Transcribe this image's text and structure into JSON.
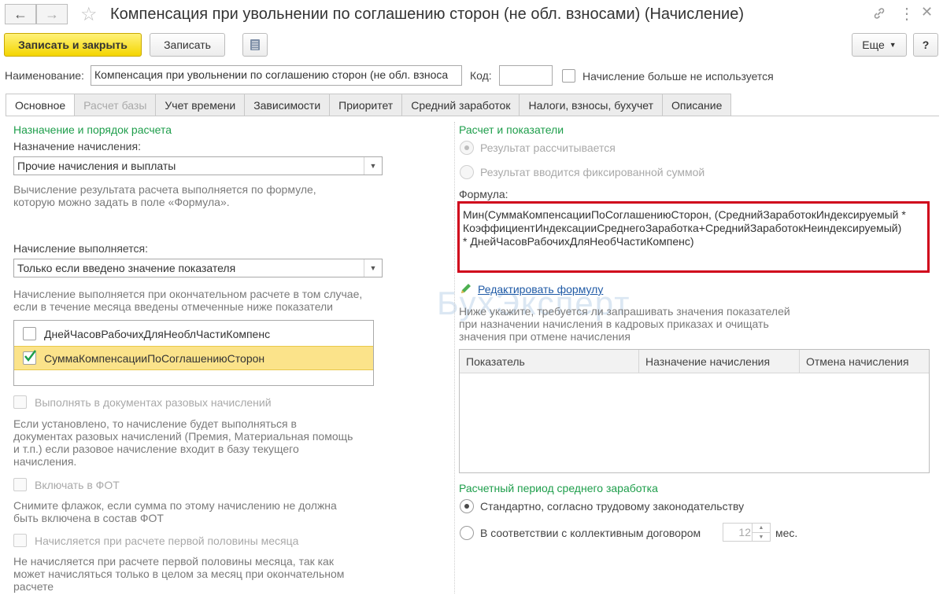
{
  "window": {
    "title": "Компенсация при увольнении по соглашению сторон (не обл. взносами) (Начисление)"
  },
  "toolbar": {
    "save_close": "Записать и закрыть",
    "save": "Записать",
    "more": "Еще",
    "help": "?"
  },
  "header": {
    "name_label": "Наименование:",
    "name_value": "Компенсация при увольнении по соглашению сторон (не обл. взноса",
    "code_label": "Код:",
    "code_value": "",
    "not_used_label": "Начисление больше не используется"
  },
  "tabs": [
    {
      "label": "Основное"
    },
    {
      "label": "Расчет базы"
    },
    {
      "label": "Учет времени"
    },
    {
      "label": "Зависимости"
    },
    {
      "label": "Приоритет"
    },
    {
      "label": "Средний заработок"
    },
    {
      "label": "Налоги, взносы, бухучет"
    },
    {
      "label": "Описание"
    }
  ],
  "left": {
    "group_title": "Назначение и порядок расчета",
    "purpose_label": "Назначение начисления:",
    "purpose_value": "Прочие начисления и выплаты",
    "purpose_note_1": "Вычисление результата расчета выполняется по формуле,",
    "purpose_note_2": "которую можно задать в поле «Формула».",
    "exec_label": "Начисление выполняется:",
    "exec_value": "Только если введено значение показателя",
    "exec_note_1": "Начисление выполняется при окончательном расчете в том случае,",
    "exec_note_2": "если в течение месяца введены отмеченные ниже показатели",
    "indicators": [
      {
        "label": "ДнейЧасовРабочихДляНеоблЧастиКомпенс",
        "checked": false
      },
      {
        "label": "СуммаКомпенсацииПоСоглашениюСторон",
        "checked": true
      }
    ],
    "one_time_label": "Выполнять в документах разовых начислений",
    "one_time_note_1": "Если установлено, то начисление будет выполняться в",
    "one_time_note_2": "документах разовых начислений (Премия, Материальная помощь",
    "one_time_note_3": "и т.п.) если разовое начисление входит в базу текущего",
    "one_time_note_4": "начисления.",
    "fot_label": "Включать в ФОТ",
    "fot_note_1": "Снимите флажок, если сумма по этому начислению не должна",
    "fot_note_2": "быть включена в состав ФОТ",
    "half_label": "Начисляется при расчете первой половины месяца",
    "half_note_1": "Не начисляется при расчете первой половины месяца, так как",
    "half_note_2": "может начисляться только в целом за месяц при окончательном",
    "half_note_3": "расчете"
  },
  "right": {
    "group_title": "Расчет и показатели",
    "radio_calc": "Результат рассчитывается",
    "radio_fixed": "Результат вводится фиксированной суммой",
    "formula_label": "Формула:",
    "formula_line_1": "Мин(СуммаКомпенсацииПоСоглашениюСторон, (СреднийЗаработокИндексируемый *",
    "formula_line_2": "КоэффициентИндексацииСреднегоЗаработка+СреднийЗаработокНеиндексируемый)",
    "formula_line_3": "* ДнейЧасовРабочихДляНеобЧастиКомпенс)",
    "edit_formula": "Редактировать формулу",
    "ask_note_1": "Ниже укажите, требуется ли запрашивать значения показателей",
    "ask_note_2": "при назначении начисления в кадровых приказах и очищать",
    "ask_note_3": "значения при отмене начисления",
    "grid_cols": [
      "Показатель",
      "Назначение начисления",
      "Отмена начисления"
    ],
    "avg_title": "Расчетный период среднего заработка",
    "avg_standard": "Стандартно, согласно трудовому законодательству",
    "avg_collective": "В соответствии с коллективным договором",
    "months_value": "12",
    "months_unit": "мес."
  },
  "watermark": "БухЭксперт",
  "colors": {
    "accent_green": "#1e9e4b",
    "primary_button": "#f4d500",
    "highlight_row": "#fbe38a",
    "formula_border": "#d0021b",
    "link": "#1f5aa6"
  }
}
